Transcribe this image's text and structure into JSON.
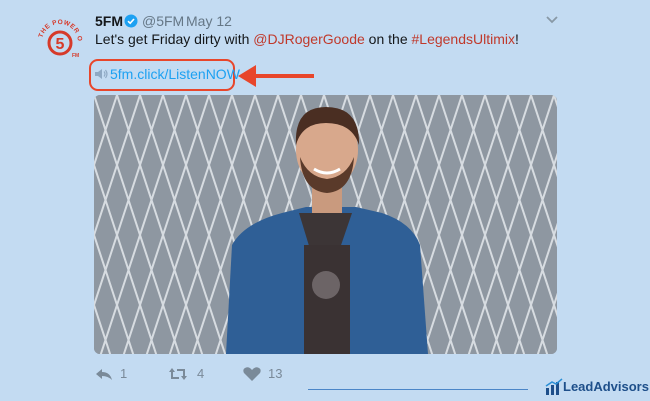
{
  "tweet": {
    "display_name": "5FM",
    "handle": "@5FM",
    "separator": "·",
    "date": "May 12",
    "text_start": "Let's get Friday dirty with ",
    "mention": "@DJRogerGoode",
    "text_middle": " on the ",
    "hashtag": "#LegendsUltimix",
    "text_end": "!",
    "link": "5fm.click/ListenNOW"
  },
  "logo": {
    "arc_text": "THE POWER OF",
    "numeral": "5",
    "suffix": "FM"
  },
  "actions": {
    "reply_count": "1",
    "retweet_count": "4",
    "like_count": "13"
  },
  "icons": {
    "verified": "verified-badge-icon",
    "chevron": "chevron-down-icon",
    "speaker": "speaker-icon",
    "reply": "reply-icon",
    "retweet": "retweet-icon",
    "like": "heart-icon",
    "brand": "bar-chart-icon"
  },
  "brand": {
    "name": "LeadAdvisors"
  },
  "colors": {
    "background": "#c3dbf2",
    "accent_red": "#e8462b",
    "link_blue": "#1da1f2",
    "mention_red": "#c0392b",
    "brand_blue": "#1e4f8a"
  }
}
